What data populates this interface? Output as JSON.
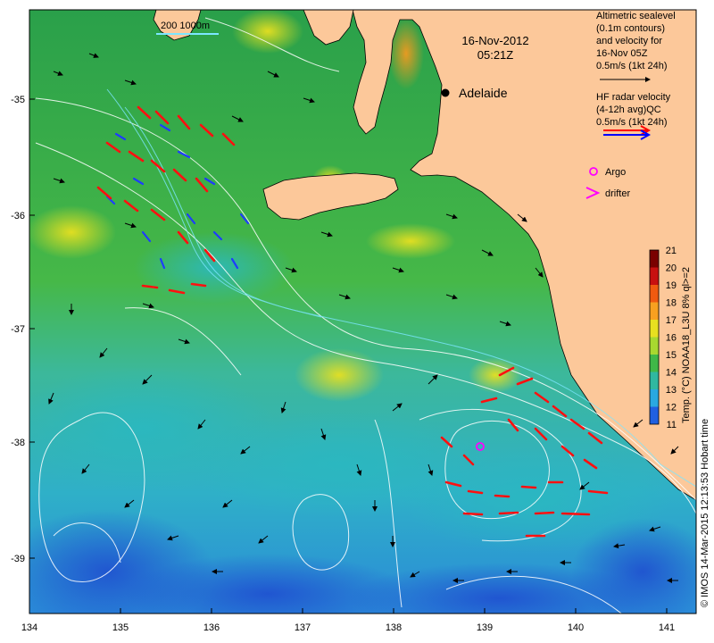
{
  "map": {
    "date": "16-Nov-2012",
    "time": "05:21Z",
    "city": "Adelaide",
    "scale_label": "200  1000m",
    "x_ticks": [
      "134",
      "135",
      "136",
      "137",
      "138",
      "139",
      "140",
      "141"
    ],
    "y_ticks": [
      "-35",
      "-36",
      "-37",
      "-38",
      "-39"
    ],
    "land_color": "#fcc89a",
    "ocean_color": "#2aa64a"
  },
  "legend": {
    "altimetric_lines": [
      "Altimetric sealevel",
      "(0.1m contours)",
      "and velocity for",
      "16-Nov 05Z",
      "0.5m/s (1kt 24h)"
    ],
    "radar_lines": [
      "HF radar velocity",
      "(4-12h avg)QC",
      "0.5m/s (1kt 24h)"
    ],
    "argo_label": "Argo",
    "drifter_label": "drifter",
    "argo_color": "#ff00ff",
    "radar_color_1": "#ff0000",
    "radar_color_2": "#0000ff"
  },
  "colorbar": {
    "ticks": [
      "21",
      "20",
      "19",
      "18",
      "17",
      "16",
      "15",
      "14",
      "13",
      "12",
      "11"
    ],
    "label": "Temp. (°C) NOAA18_L3U 8% ql>=2",
    "credit": "© IMOS 14-Mar-2015 12:13:53 Hobart time"
  }
}
